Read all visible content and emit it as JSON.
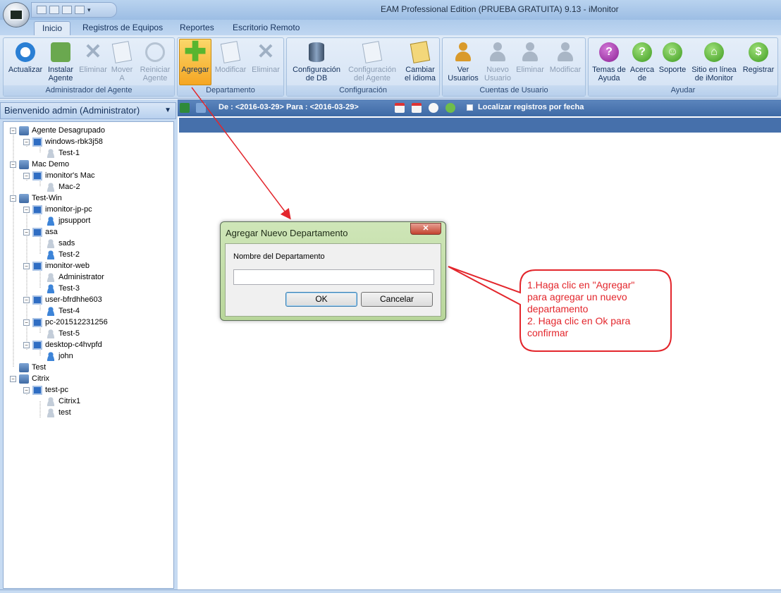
{
  "window": {
    "title": "EAM Professional Edition (PRUEBA GRATUITA) 9.13 - iMonitor"
  },
  "tabs": [
    "Inicio",
    "Registros de Equipos",
    "Reportes",
    "Escritorio Remoto"
  ],
  "ribbon": {
    "groups": [
      {
        "label": "Administrador del Agente",
        "buttons": [
          "Actualizar",
          "Instalar\nAgente",
          "Eliminar",
          "Mover\nA",
          "Reiniciar\nAgente"
        ]
      },
      {
        "label": "Departamento",
        "buttons": [
          "Agregar",
          "Modificar",
          "Eliminar"
        ]
      },
      {
        "label": "Configuración",
        "buttons": [
          "Configuración\nde DB",
          "Configuración\ndel Agente",
          "Cambiar\nel idioma"
        ]
      },
      {
        "label": "Cuentas de Usuario",
        "buttons": [
          "Ver\nUsuarios",
          "Nuevo\nUsuario",
          "Eliminar",
          "Modificar"
        ]
      },
      {
        "label": "Ayudar",
        "buttons": [
          "Temas de\nAyuda",
          "Acerca\nde",
          "Soporte",
          "Sitio en línea\nde iMonitor",
          "Registrar"
        ]
      }
    ]
  },
  "left_panel": {
    "header": "Bienvenido admin (Administrator)",
    "tree": [
      "Agente Desagrupado",
      "windows-rbk3j58",
      "Test-1",
      "Mac Demo",
      "imonitor's Mac",
      "Mac-2",
      "Test-Win",
      "imonitor-jp-pc",
      "jpsupport",
      "asa",
      "sads",
      "Test-2",
      "imonitor-web",
      "Administrator",
      "Test-3",
      "user-bfrdhhe603",
      "Test-4",
      "pc-201512231256",
      "Test-5",
      "desktop-c4hvpfd",
      "john",
      "Test",
      "Citrix",
      "test-pc",
      "Citrix1",
      "test"
    ]
  },
  "toolbar": {
    "date_range": "De : <2016-03-29> Para : <2016-03-29>",
    "locate_label": "Localizar registros por fecha"
  },
  "dialog": {
    "title": "Agregar Nuevo Departamento",
    "field_label": "Nombre del Departamento",
    "field_value": "",
    "ok": "OK",
    "cancel": "Cancelar"
  },
  "annotation": {
    "text": "1.Haga clic en \"Agregar\"\npara agregar un nuevo\ndepartamento\n2. Haga clic en Ok para\nconfirmar",
    "color": "#e3262c"
  }
}
